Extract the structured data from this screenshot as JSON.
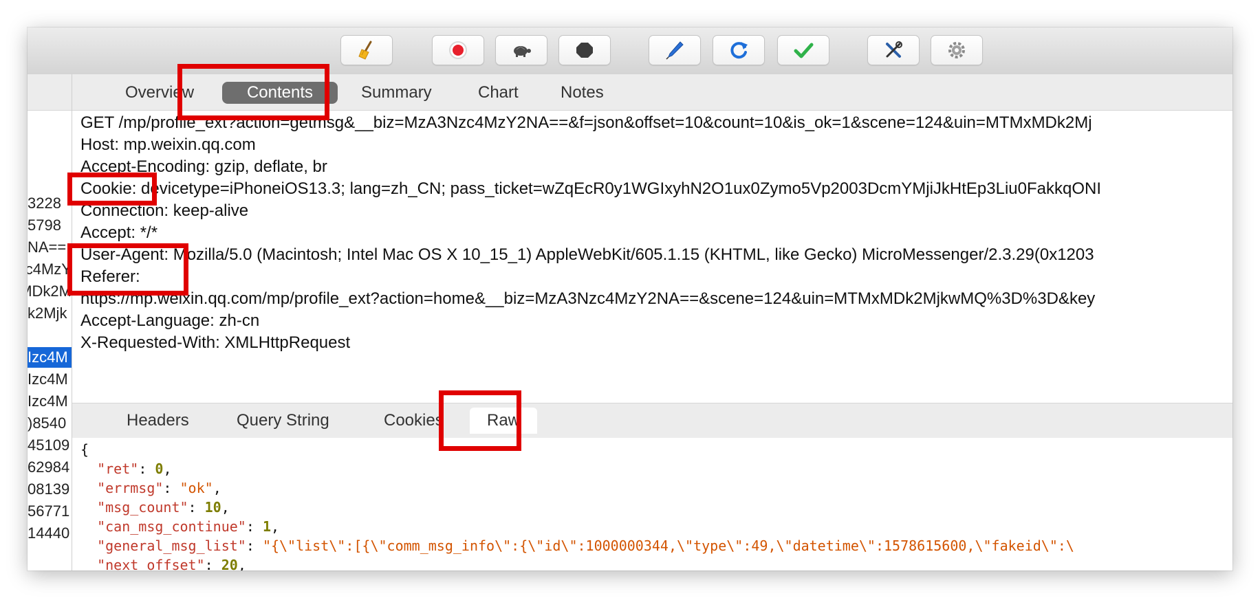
{
  "toolbar": {
    "buttons": [
      {
        "name": "broom-icon"
      },
      {
        "name": "record-icon",
        "color": "#e8202c"
      },
      {
        "name": "turtle-icon"
      },
      {
        "name": "stop-icon"
      },
      {
        "name": "pen-icon",
        "color": "#2a6fd6"
      },
      {
        "name": "refresh-icon",
        "color": "#1e6fd9"
      },
      {
        "name": "checkmark-icon",
        "color": "#2fb24a"
      },
      {
        "name": "tools-icon"
      },
      {
        "name": "gear-icon"
      }
    ]
  },
  "sidebar": {
    "rows": [
      {
        "text": "3228",
        "selected": false
      },
      {
        "text": "5798",
        "selected": false
      },
      {
        "text": "NA==",
        "selected": false
      },
      {
        "text": "c4MzY",
        "selected": false
      },
      {
        "text": "MDk2M",
        "selected": false
      },
      {
        "text": "k2Mjk",
        "selected": false
      },
      {
        "text": "Izc4M",
        "selected": true
      },
      {
        "text": "Izc4M",
        "selected": false
      },
      {
        "text": "Izc4M",
        "selected": false
      },
      {
        "text": ")8540",
        "selected": false
      },
      {
        "text": "45109",
        "selected": false
      },
      {
        "text": "62984",
        "selected": false
      },
      {
        "text": "08139",
        "selected": false
      },
      {
        "text": "56771",
        "selected": false
      },
      {
        "text": "14440",
        "selected": false
      }
    ]
  },
  "tabs": {
    "overview": "Overview",
    "contents": "Contents",
    "summary": "Summary",
    "chart": "Chart",
    "notes": "Notes"
  },
  "request": {
    "lines": [
      "GET /mp/profile_ext?action=getmsg&__biz=MzA3Nzc4MzY2NA==&f=json&offset=10&count=10&is_ok=1&scene=124&uin=MTMxMDk2Mj",
      "Host: mp.weixin.qq.com",
      "Accept-Encoding: gzip, deflate, br",
      "Cookie: devicetype=iPhoneiOS13.3; lang=zh_CN; pass_ticket=wZqEcR0y1WGIxyhN2O1ux0Zymo5Vp2003DcmYMjiJkHtEp3Liu0FakkqONI",
      "Connection: keep-alive",
      "Accept: */*",
      "User-Agent: Mozilla/5.0 (Macintosh; Intel Mac OS X 10_15_1) AppleWebKit/605.1.15 (KHTML, like Gecko) MicroMessenger/2.3.29(0x1203",
      "Referer:",
      "https://mp.weixin.qq.com/mp/profile_ext?action=home&__biz=MzA3Nzc4MzY2NA==&scene=124&uin=MTMxMDk2MjkwMQ%3D%3D&key",
      "Accept-Language: zh-cn",
      "X-Requested-With: XMLHttpRequest"
    ]
  },
  "subtabs": {
    "headers": "Headers",
    "query_string": "Query String",
    "cookies": "Cookies",
    "raw": "Raw"
  },
  "response": {
    "open_brace": "{",
    "fields": [
      {
        "key": "\"ret\"",
        "value": "0",
        "type": "number"
      },
      {
        "key": "\"errmsg\"",
        "value": "\"ok\"",
        "type": "string"
      },
      {
        "key": "\"msg_count\"",
        "value": "10",
        "type": "number"
      },
      {
        "key": "\"can_msg_continue\"",
        "value": "1",
        "type": "number"
      },
      {
        "key": "\"general_msg_list\"",
        "value": "\"{\\\"list\\\":[{\\\"comm_msg_info\\\":{\\\"id\\\":1000000344,\\\"type\\\":49,\\\"datetime\\\":1578615600,\\\"fakeid\\\":\\",
        "type": "string"
      },
      {
        "key": "\"next_offset\"",
        "value": "20",
        "type": "number"
      }
    ]
  },
  "annotation_color": "#e00000"
}
